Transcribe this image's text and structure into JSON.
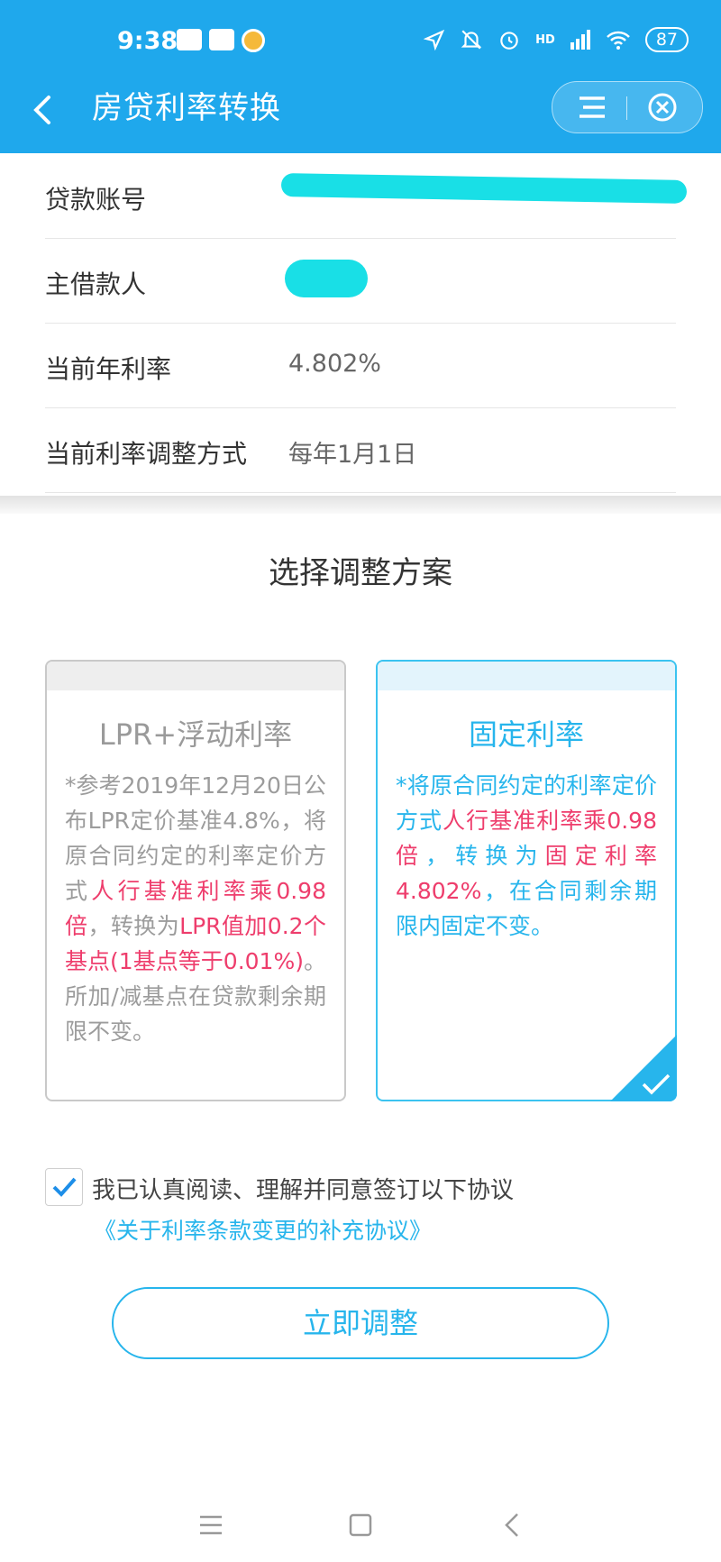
{
  "status_bar": {
    "time": "9:38",
    "battery": "87",
    "network": "HD"
  },
  "header": {
    "title": "房贷利率转换"
  },
  "loan_info": {
    "rows": [
      {
        "label": "贷款账号",
        "value": ""
      },
      {
        "label": "主借款人",
        "value": ""
      },
      {
        "label": "当前年利率",
        "value": "4.802%"
      },
      {
        "label": "当前利率调整方式",
        "value": "每年1月1日"
      }
    ]
  },
  "plan": {
    "title": "选择调整方案",
    "options": [
      {
        "name": "LPR+浮动利率",
        "desc_parts": [
          "*参考2019年12月20日公布LPR定价基准4.8%，将原合同约定的利率定价方式",
          "人行基准利率乘0.98倍",
          "，转换为",
          "LPR值加0.2个基点(1基点等于0.01%)",
          "。所加/减基点在贷款剩余期限不变。"
        ]
      },
      {
        "name": "固定利率",
        "selected": true,
        "desc_parts": [
          "*将原合同约定的利率定价方式",
          "人行基准利率乘0.98倍",
          "，转换为",
          "固定利率4.802%",
          "，在合同剩余期限内固定不变。"
        ]
      }
    ]
  },
  "agreement": {
    "checked": true,
    "text": "我已认真阅读、理解并同意签订以下协议",
    "link": "《关于利率条款变更的补充协议》"
  },
  "submit_label": "立即调整",
  "colors": {
    "header": "#1fa8ec",
    "accent": "#27b5ec",
    "highlight": "#ee3d6c",
    "mask": "#19dfe6"
  }
}
